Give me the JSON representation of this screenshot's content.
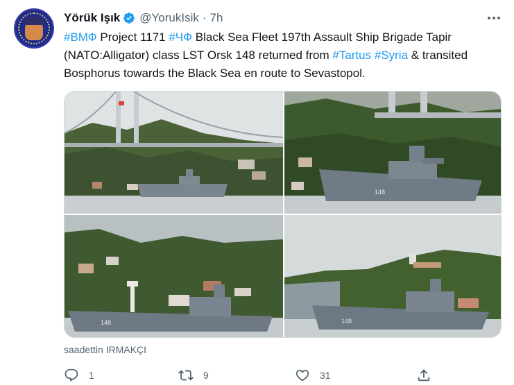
{
  "tweet": {
    "author_name": "Yörük Işık",
    "handle": "@YorukIsik",
    "separator": "·",
    "time": "7h",
    "text_parts": {
      "tag1": "#ВМФ",
      "t1": " Project 1171 ",
      "tag2": "#ЧФ",
      "t2": " Black Sea Fleet 197th Assault Ship Brigade Tapir (NATO:Alligator) class LST Orsk 148 returned from ",
      "tag3": "#Tartus",
      "t3": " ",
      "tag4": "#Syria",
      "t4": " & transited Bosphorus towards the Black Sea en route to Sevastopol."
    },
    "photo_credit": "saadettin IRMAKÇI",
    "hull_number": "148"
  },
  "actions": {
    "reply_count": "1",
    "retweet_count": "9",
    "like_count": "31"
  },
  "icons": {
    "verified": "verified-badge-icon",
    "more": "more-options-icon",
    "reply": "reply-icon",
    "retweet": "retweet-icon",
    "like": "heart-icon",
    "share": "share-icon"
  },
  "colors": {
    "link": "#1d9bf0",
    "text": "#0f1419",
    "muted": "#536471",
    "verified": "#1d9bf0"
  }
}
